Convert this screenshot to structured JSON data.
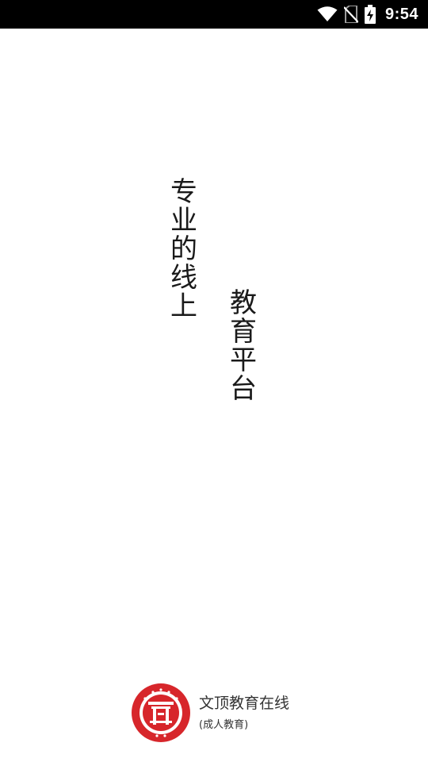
{
  "status_bar": {
    "time": "9:54",
    "icons": [
      "wifi-icon",
      "no-sim-icon",
      "battery-charging-icon"
    ],
    "background": "#000000",
    "foreground": "#ffffff"
  },
  "slogan": {
    "column_1": [
      "专",
      "业",
      "的",
      "线",
      "上"
    ],
    "column_2": [
      "教",
      "育",
      "平",
      "台"
    ]
  },
  "brand": {
    "logo": "wending-education-seal-logo",
    "name": "文顶教育在线",
    "subtitle": "(成人教育)",
    "logo_color": "#d7262b"
  }
}
